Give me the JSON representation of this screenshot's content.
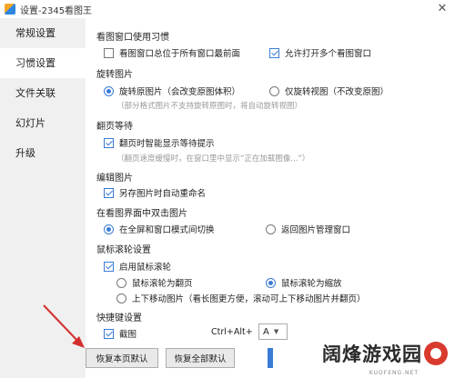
{
  "window": {
    "title": "设置-2345看图王",
    "close_glyph": "✕"
  },
  "sidebar": {
    "items": [
      {
        "label": "常规设置",
        "active": false
      },
      {
        "label": "习惯设置",
        "active": true
      },
      {
        "label": "文件关联",
        "active": false
      },
      {
        "label": "幻灯片",
        "active": false
      },
      {
        "label": "升级",
        "active": false
      }
    ]
  },
  "sections": {
    "window": {
      "title": "看图窗口使用习惯",
      "always_on_top": "看图窗口总位于所有窗口最前面",
      "allow_multiple": "允许打开多个看图窗口"
    },
    "rotate": {
      "title": "旋转图片",
      "rotate_original": "旋转原图片（会改变原图体积）",
      "rotate_view_only": "仅旋转视图（不改变原图）",
      "note": "（部分格式图片不支持旋转原图时，将自动旋转视图）"
    },
    "page_wait": {
      "title": "翻页等待",
      "smart_hint": "翻页时智能显示等待提示",
      "note": "（翻页速度缓慢时，在窗口里中显示“正在加载图像...”）"
    },
    "edit": {
      "title": "编辑图片",
      "auto_rename": "另存图片时自动重命名"
    },
    "double_click": {
      "title": "在看图界面中双击图片",
      "toggle_fullscreen": "在全屏和窗口模式间切换",
      "return_manager": "返回图片管理窗口"
    },
    "wheel": {
      "title": "鼠标滚轮设置",
      "enable": "启用鼠标滚轮",
      "page": "鼠标滚轮为翻页",
      "zoom": "鼠标滚轮为缩放",
      "move": "上下移动图片（看长图更方便，滚动可上下移动图片并翻页）"
    },
    "shortcut": {
      "title": "快捷键设置",
      "screenshot": "截图",
      "combo": "Ctrl+Alt+",
      "key": "A",
      "arrow_glyph": "▼"
    }
  },
  "buttons": {
    "restore_current": "恢复本页默认",
    "restore_all": "恢复全部默认"
  },
  "watermark": {
    "text": "阔烽游戏园",
    "url": "KUOFENG.NET"
  },
  "colors": {
    "accent": "#3a7bd5",
    "annotation_arrow": "#d32f2f",
    "sidebar_bg": "#f0f0f0"
  }
}
